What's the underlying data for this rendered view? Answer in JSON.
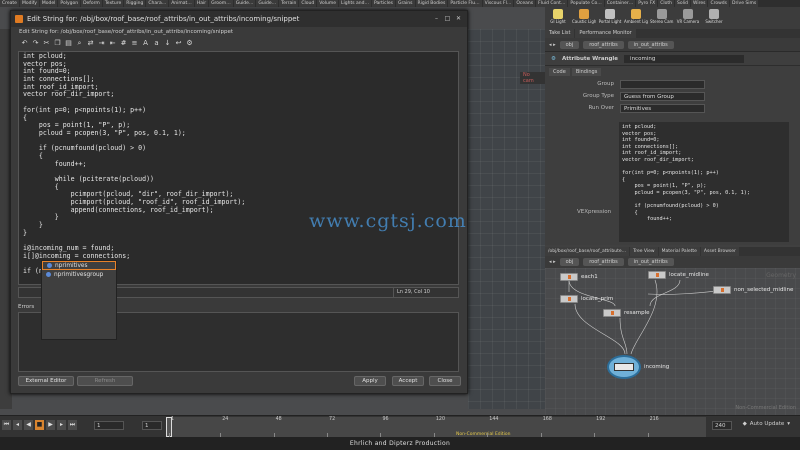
{
  "shelf_tabs": [
    "Create",
    "Modify",
    "Model",
    "Polygon",
    "Deform",
    "Texture",
    "Rigging",
    "Chara…",
    "Animat…",
    "Hair",
    "Groom…",
    "Guide…",
    "Guide…",
    "Terrain",
    "Cloud",
    "Volume",
    "Lights and…",
    "Particles",
    "Grains",
    "Rigid Bodies",
    "Particle Flu…",
    "Viscous Fl…",
    "Oceans",
    "Fluid Cont…",
    "Populate Co…",
    "Container…",
    "Pyro FX",
    "Cloth",
    "Solid",
    "Wires",
    "Crowds",
    "Drive Sims"
  ],
  "shelf_tools": [
    {
      "label": "Distant Light",
      "color": "#e6c84a"
    },
    {
      "label": "Environment…",
      "color": "#7ab0d8"
    },
    {
      "label": "Sky Light",
      "color": "#88bde0"
    },
    {
      "label": "GI Light",
      "color": "#e8d36a"
    },
    {
      "label": "Caustic Light",
      "color": "#e0a040"
    },
    {
      "label": "Portal Light",
      "color": "#c0c0c0"
    },
    {
      "label": "Ambient Lig…",
      "color": "#e6b04a"
    },
    {
      "label": "Stereo Cam…",
      "color": "#9a9a9a"
    },
    {
      "label": "VR Camera",
      "color": "#9a9a9a"
    },
    {
      "label": "Switcher",
      "color": "#b0b0b0"
    }
  ],
  "dialog": {
    "title": "Edit String for: /obj/box/roof_base/roof_attribs/in_out_attribs/incoming/snippet",
    "path": "Edit String for: /obj/box/roof_base/roof_attribs/in_out_attribs/incoming/snippet",
    "code_lines": [
      "int pcloud;",
      "vector pos;",
      "int found=0;",
      "int connections[];",
      "int roof_id_import;",
      "vector roof_dir_import;",
      "",
      "for(int p=0; p<npoints(1); p++)",
      "{",
      "    pos = point(1, \"P\", p);",
      "    pcloud = pcopen(3, \"P\", pos, 0.1, 1);",
      "",
      "    if (pcnumfound(pcloud) > 0)",
      "    {",
      "        found++;",
      "",
      "        while (pciterate(pcloud))",
      "        {",
      "            pcimport(pcloud, \"dir\", roof_dir_import);",
      "            pcimport(pcloud, \"roof_id\", roof_id_import);",
      "            append(connections, roof_id_import);",
      "        }",
      "    }",
      "}",
      "",
      "i@incoming_num = found;",
      "i[]@incoming = connections;",
      "",
      "if (nprim"
    ],
    "cursor_pos": "Ln 29, Col 10",
    "errors_label": "Errors",
    "buttons": {
      "external_editor": "External Editor",
      "refresh": "Refresh",
      "apply": "Apply",
      "accept": "Accept",
      "close": "Close"
    },
    "autocomplete": [
      "nprimitives",
      "nprimitivesgroup"
    ]
  },
  "param_panel": {
    "tabs": [
      "Take List",
      "Performance Monitor"
    ],
    "path_obj": "obj",
    "path_node": "roof_attribs",
    "path_node2": "in_out_attribs",
    "node_type": "Attribute Wrangle",
    "node_name": "incoming",
    "ptabs": [
      "Code",
      "Bindings"
    ],
    "rows": [
      {
        "label": "Group",
        "value": ""
      },
      {
        "label": "Group Type",
        "value": "Guess from Group"
      },
      {
        "label": "Run Over",
        "value": "Primitives"
      }
    ],
    "vexpression_label": "VEXpression",
    "code_preview": "int pcloud;\nvector pos;\nint found=0;\nint connections[];\nint roof_id_import;\nvector roof_dir_import;\n\nfor(int p=0; p<npoints(1); p++)\n{\n    pos = point(1, \"P\", p);\n    pcloud = pcopen(3, \"P\", pos, 0.1, 1);\n\n    if (pcnumfound(pcloud) > 0)\n    {\n        found++;"
  },
  "network": {
    "tabs": [
      "/obj/box/roof_base/roof_attribute…",
      "Tree View",
      "Material Palette",
      "Asset Browser"
    ],
    "path_obj": "obj",
    "path_node": "roof_attribs",
    "path_node2": "in_out_attribs",
    "watermark": "Geometry",
    "watermark2": "Non-Commercial Edition",
    "nodes": {
      "each1": "each1",
      "locate_midline": "locate_midline",
      "non_selected_midline": "non_selected_midline",
      "locate_prim": "locate_prim",
      "resample": "resample",
      "incoming": "incoming"
    }
  },
  "viewport": {
    "camera_label": "No cam"
  },
  "watermark": "www.cgtsj.com",
  "timeline": {
    "frame": "1",
    "start": "1",
    "start2": "1",
    "end": "240",
    "end2": "240",
    "ticks": [
      "1",
      "24",
      "48",
      "72",
      "96",
      "120",
      "144",
      "168",
      "192",
      "216"
    ],
    "nc_label": "Non-Commercial Edition",
    "auto_update": "Auto Update"
  },
  "footer": "Ehrlich   and   Dipterz  Production"
}
